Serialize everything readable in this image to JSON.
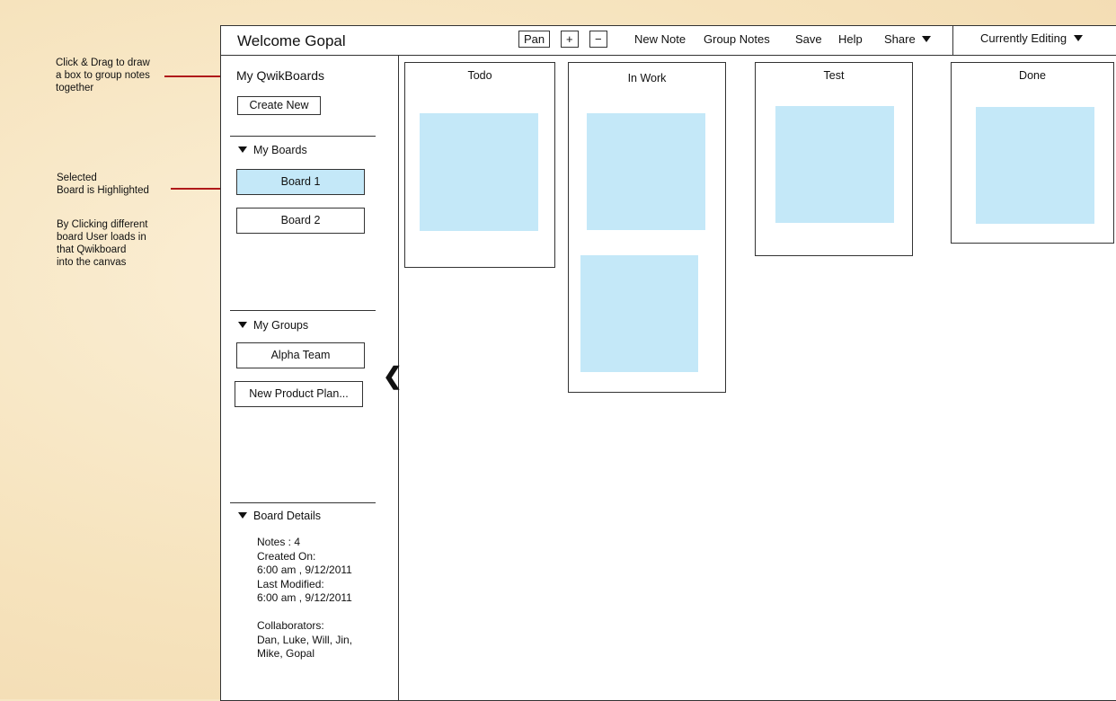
{
  "annotations": {
    "drag_note": "Click & Drag to draw\na box to group notes\ntogether",
    "selected_note": "Selected\nBoard is Highlighted",
    "click_note": "By Clicking different\nboard User loads in\nthat Qwikboard\ninto the canvas"
  },
  "header": {
    "welcome": "Welcome Gopal",
    "pan": "Pan",
    "zoom_in": "+",
    "zoom_out": "−",
    "new_note": "New Note",
    "group_notes": "Group Notes",
    "save": "Save",
    "help": "Help",
    "share": "Share",
    "currently_editing": "Currently Editing"
  },
  "sidebar": {
    "title": "My QwikBoards",
    "create_new": "Create New",
    "boards_header": "My Boards",
    "boards": [
      "Board 1",
      "Board 2"
    ],
    "groups_header": "My Groups",
    "groups": [
      "Alpha Team",
      "New Product Plan..."
    ],
    "collapse": "❮",
    "details_header": "Board Details",
    "details": "Notes : 4\nCreated On:\n6:00 am , 9/12/2011\nLast Modified:\n6:00 am , 9/12/2011\n\nCollaborators:\nDan, Luke, Will, Jin,\nMike, Gopal"
  },
  "columns": [
    "Todo",
    "In Work",
    "Test",
    "Done"
  ],
  "colors": {
    "note": "#c4e8f8",
    "arrow": "#b0191a",
    "background": "#f7e6c4"
  }
}
